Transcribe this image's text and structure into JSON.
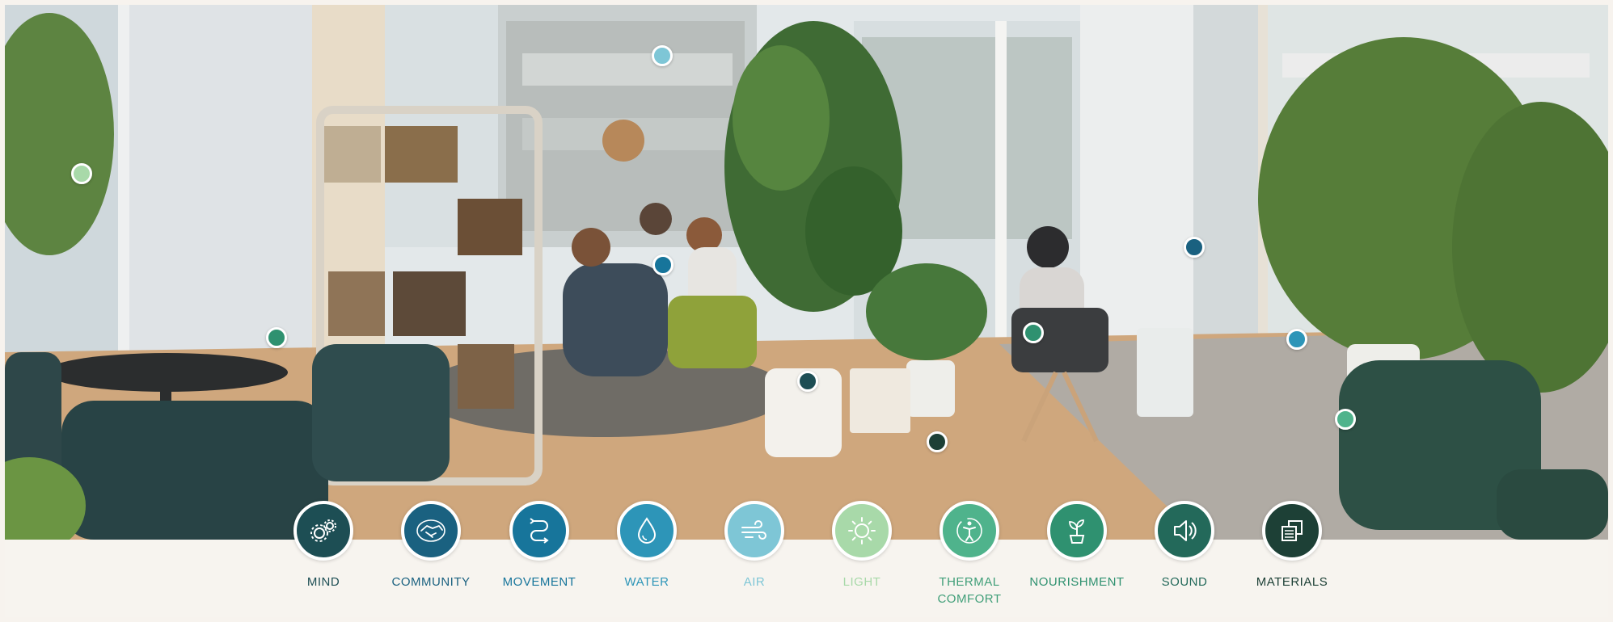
{
  "colors": {
    "mind": "#1d4e54",
    "community": "#1a6180",
    "movement": "#17759b",
    "water": "#2d95b8",
    "air": "#7ec6d6",
    "light": "#a8d9a9",
    "thermal": "#4fb38c",
    "nourishment": "#2f9170",
    "sound": "#23695a",
    "materials": "#1d4036"
  },
  "categories": [
    {
      "id": "mind",
      "label": "MIND",
      "icon": "gears-icon",
      "color": "#1d4e54",
      "label_color": "#1d4e54"
    },
    {
      "id": "community",
      "label": "COMMUNITY",
      "icon": "handshake-icon",
      "color": "#1a6180",
      "label_color": "#1a6180"
    },
    {
      "id": "movement",
      "label": "MOVEMENT",
      "icon": "path-arrows-icon",
      "color": "#17759b",
      "label_color": "#17759b"
    },
    {
      "id": "water",
      "label": "WATER",
      "icon": "water-drop-icon",
      "color": "#2d95b8",
      "label_color": "#2d95b8"
    },
    {
      "id": "air",
      "label": "AIR",
      "icon": "wind-icon",
      "color": "#7ec6d6",
      "label_color": "#7ec6d6"
    },
    {
      "id": "light",
      "label": "LIGHT",
      "icon": "sun-icon",
      "color": "#a8d9a9",
      "label_color": "#a8d9a9"
    },
    {
      "id": "thermal",
      "label": "THERMAL\nCOMFORT",
      "icon": "thermal-person-icon",
      "color": "#4fb38c",
      "label_color": "#3f9e78"
    },
    {
      "id": "nourishment",
      "label": "NOURISHMENT",
      "icon": "sprout-icon",
      "color": "#2f9170",
      "label_color": "#2f9170"
    },
    {
      "id": "sound",
      "label": "SOUND",
      "icon": "speaker-icon",
      "color": "#23695a",
      "label_color": "#23695a"
    },
    {
      "id": "materials",
      "label": "MATERIALS",
      "icon": "layers-icon",
      "color": "#1d4036",
      "label_color": "#1d4036"
    }
  ],
  "hotspots": [
    {
      "category": "air",
      "color": "#7ec6d6"
    },
    {
      "category": "light",
      "color": "#a8d9a9"
    },
    {
      "category": "thermal",
      "color": "#2f9170"
    },
    {
      "category": "movement",
      "color": "#17759b"
    },
    {
      "category": "mind",
      "color": "#1d4e54"
    },
    {
      "category": "materials",
      "color": "#1d4036"
    },
    {
      "category": "nourishment",
      "color": "#2f9170"
    },
    {
      "category": "community",
      "color": "#1a6180"
    },
    {
      "category": "water",
      "color": "#2d95b8"
    },
    {
      "category": "thermal",
      "color": "#4fb38c"
    }
  ]
}
